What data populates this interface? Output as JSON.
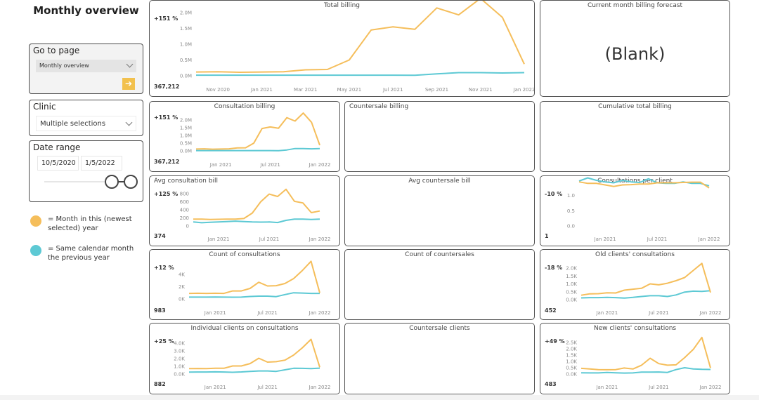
{
  "page": {
    "title": "Monthly overview"
  },
  "slicers": {
    "goto_page": {
      "label": "Go to page",
      "selected": "Monthly overview",
      "go_icon": "➔"
    },
    "clinic": {
      "label": "Clinic",
      "selected": "Multiple selections"
    },
    "date_range": {
      "label": "Date range",
      "start": "10/5/2020",
      "end": "1/5/2022"
    }
  },
  "legend": [
    {
      "text": "= Month in this (newest selected) year",
      "color": "#F5BE5B"
    },
    {
      "text": "= Same calendar month the previous year",
      "color": "#5DC9D4"
    }
  ],
  "colors": {
    "current": "#F5BE5B",
    "previous": "#5DC9D4"
  },
  "blank_cards": {
    "forecast": {
      "title": "Current month billing forecast",
      "text": "(Blank)"
    },
    "cumulative": {
      "title": "Cumulative total billing"
    },
    "countersale_billing": {
      "title": "Countersale billing"
    },
    "avg_countersale": {
      "title": "Avg countersale bill"
    },
    "count_countersales": {
      "title": "Count of countersales"
    },
    "countersale_clients": {
      "title": "Countersale clients"
    }
  },
  "chart_data": [
    {
      "id": "total_billing",
      "type": "line",
      "title": "Total billing",
      "kpi_pct": "+151 %",
      "kpi_value": "367,212",
      "x": [
        "Oct 2020",
        "Nov 2020",
        "Dec 2020",
        "Jan 2021",
        "Feb 2021",
        "Mar 2021",
        "Apr 2021",
        "May 2021",
        "Jun 2021",
        "Jul 2021",
        "Aug 2021",
        "Sep 2021",
        "Oct 2021",
        "Nov 2021",
        "Dec 2021",
        "Jan 2022"
      ],
      "xticks": [
        "Nov 2020",
        "Jan 2021",
        "Mar 2021",
        "May 2021",
        "Jul 2021",
        "Sep 2021",
        "Nov 2021",
        "Jan 2022"
      ],
      "xtick_idx": [
        1,
        3,
        5,
        7,
        9,
        11,
        13,
        15
      ],
      "yticks": [
        "0.0M",
        "0.5M",
        "1.0M",
        "1.5M",
        "2.0M"
      ],
      "ylim": [
        0,
        2000000
      ],
      "series": [
        {
          "name": "Current year",
          "values": [
            120000,
            130000,
            110000,
            120000,
            130000,
            190000,
            200000,
            500000,
            1450000,
            1550000,
            1470000,
            2150000,
            1930000,
            2450000,
            1850000,
            370000
          ]
        },
        {
          "name": "Previous year",
          "values": [
            20000,
            20000,
            20000,
            20000,
            20000,
            20000,
            20000,
            20000,
            20000,
            20000,
            15000,
            60000,
            100000,
            100000,
            90000,
            100000
          ]
        }
      ]
    },
    {
      "id": "consultation_billing",
      "type": "line",
      "title": "Consultation billing",
      "kpi_pct": "+151 %",
      "kpi_value": "367,212",
      "x": [
        "Oct 2020",
        "Nov 2020",
        "Dec 2020",
        "Jan 2021",
        "Feb 2021",
        "Mar 2021",
        "Apr 2021",
        "May 2021",
        "Jun 2021",
        "Jul 2021",
        "Aug 2021",
        "Sep 2021",
        "Oct 2021",
        "Nov 2021",
        "Dec 2021",
        "Jan 2022"
      ],
      "xticks": [
        "Jan 2021",
        "Jul 2021",
        "Jan 2022"
      ],
      "xtick_idx": [
        3,
        9,
        15
      ],
      "yticks": [
        "0.0M",
        "0.5M",
        "1.0M",
        "1.5M",
        "2.0M"
      ],
      "ylim": [
        0,
        2000000
      ],
      "series": [
        {
          "name": "Current year",
          "values": [
            120000,
            130000,
            110000,
            120000,
            130000,
            190000,
            200000,
            500000,
            1450000,
            1550000,
            1470000,
            2150000,
            1930000,
            2450000,
            1850000,
            370000
          ]
        },
        {
          "name": "Previous year",
          "values": [
            20000,
            20000,
            20000,
            20000,
            20000,
            20000,
            20000,
            20000,
            20000,
            20000,
            15000,
            60000,
            150000,
            150000,
            130000,
            150000
          ]
        }
      ]
    },
    {
      "id": "avg_consultation_bill",
      "type": "line",
      "title": "Avg consultation bill",
      "kpi_pct": "+125 %",
      "kpi_value": "374",
      "x": [
        "Oct 2020",
        "Nov 2020",
        "Dec 2020",
        "Jan 2021",
        "Feb 2021",
        "Mar 2021",
        "Apr 2021",
        "May 2021",
        "Jun 2021",
        "Jul 2021",
        "Aug 2021",
        "Sep 2021",
        "Oct 2021",
        "Nov 2021",
        "Dec 2021",
        "Jan 2022"
      ],
      "xticks": [
        "Jan 2021",
        "Jul 2021",
        "Jan 2022"
      ],
      "xtick_idx": [
        3,
        9,
        15
      ],
      "yticks": [
        "0",
        "200",
        "400",
        "600",
        "800"
      ],
      "ylim": [
        0,
        800
      ],
      "series": [
        {
          "name": "Current year",
          "values": [
            170,
            170,
            160,
            165,
            170,
            170,
            185,
            320,
            600,
            790,
            730,
            910,
            610,
            570,
            330,
            370
          ]
        },
        {
          "name": "Previous year",
          "values": [
            100,
            80,
            90,
            100,
            110,
            120,
            110,
            100,
            95,
            100,
            85,
            140,
            170,
            170,
            160,
            170
          ]
        }
      ]
    },
    {
      "id": "consultations_per_client",
      "type": "line",
      "title": "Consultations per client",
      "kpi_pct": "-10 %",
      "kpi_value": "1",
      "x": [
        "Oct 2020",
        "Nov 2020",
        "Dec 2020",
        "Jan 2021",
        "Feb 2021",
        "Mar 2021",
        "Apr 2021",
        "May 2021",
        "Jun 2021",
        "Jul 2021",
        "Aug 2021",
        "Sep 2021",
        "Oct 2021",
        "Nov 2021",
        "Dec 2021",
        "Jan 2022"
      ],
      "xticks": [
        "Jan 2021",
        "Jul 2021",
        "Jan 2022"
      ],
      "xtick_idx": [
        3,
        9,
        15
      ],
      "yticks": [
        "0.0",
        "0.5",
        "1.0"
      ],
      "ylim": [
        0,
        1.5
      ],
      "series": [
        {
          "name": "Current year",
          "values": [
            1.45,
            1.4,
            1.4,
            1.35,
            1.3,
            1.35,
            1.36,
            1.38,
            1.38,
            1.42,
            1.42,
            1.42,
            1.43,
            1.44,
            1.44,
            1.25
          ]
        },
        {
          "name": "Previous year",
          "values": [
            1.48,
            1.58,
            1.5,
            1.45,
            1.42,
            1.5,
            1.45,
            1.43,
            1.55,
            1.42,
            1.4,
            1.4,
            1.45,
            1.4,
            1.4,
            1.32
          ]
        }
      ]
    },
    {
      "id": "count_of_consultations",
      "type": "line",
      "title": "Count of consultations",
      "kpi_pct": "+12 %",
      "kpi_value": "983",
      "x": [
        "Oct 2020",
        "Nov 2020",
        "Dec 2020",
        "Jan 2021",
        "Feb 2021",
        "Mar 2021",
        "Apr 2021",
        "May 2021",
        "Jun 2021",
        "Jul 2021",
        "Aug 2021",
        "Sep 2021",
        "Oct 2021",
        "Nov 2021",
        "Dec 2021",
        "Jan 2022"
      ],
      "xticks": [
        "Jan 2021",
        "Jul 2021",
        "Jan 2022"
      ],
      "xtick_idx": [
        3,
        9,
        15
      ],
      "yticks": [
        "0K",
        "2K",
        "4K"
      ],
      "ylim": [
        0,
        5000
      ],
      "series": [
        {
          "name": "Current year",
          "values": [
            900,
            920,
            900,
            920,
            900,
            1300,
            1300,
            1700,
            2700,
            2100,
            2150,
            2500,
            3300,
            4600,
            6100,
            983
          ]
        },
        {
          "name": "Previous year",
          "values": [
            300,
            300,
            300,
            320,
            300,
            280,
            300,
            400,
            450,
            450,
            380,
            700,
            1000,
            950,
            900,
            900
          ]
        }
      ]
    },
    {
      "id": "old_clients_consultations",
      "type": "line",
      "title": "Old clients' consultations",
      "kpi_pct": "-18 %",
      "kpi_value": "452",
      "x": [
        "Oct 2020",
        "Nov 2020",
        "Dec 2020",
        "Jan 2021",
        "Feb 2021",
        "Mar 2021",
        "Apr 2021",
        "May 2021",
        "Jun 2021",
        "Jul 2021",
        "Aug 2021",
        "Sep 2021",
        "Oct 2021",
        "Nov 2021",
        "Dec 2021",
        "Jan 2022"
      ],
      "xticks": [
        "Jan 2021",
        "Jul 2021",
        "Jan 2022"
      ],
      "xtick_idx": [
        3,
        9,
        15
      ],
      "yticks": [
        "0.0K",
        "0.5K",
        "1.0K",
        "1.5K",
        "2.0K"
      ],
      "ylim": [
        0,
        2000
      ],
      "series": [
        {
          "name": "Current year",
          "values": [
            280,
            370,
            380,
            430,
            420,
            600,
            660,
            720,
            1000,
            940,
            1040,
            1200,
            1400,
            1850,
            2300,
            452
          ]
        },
        {
          "name": "Previous year",
          "values": [
            110,
            130,
            130,
            140,
            130,
            100,
            140,
            200,
            250,
            250,
            200,
            300,
            480,
            540,
            520,
            570
          ]
        }
      ]
    },
    {
      "id": "individual_clients_on_consultations",
      "type": "line",
      "title": "Individual clients on consultations",
      "kpi_pct": "+25 %",
      "kpi_value": "882",
      "x": [
        "Oct 2020",
        "Nov 2020",
        "Dec 2020",
        "Jan 2021",
        "Feb 2021",
        "Mar 2021",
        "Apr 2021",
        "May 2021",
        "Jun 2021",
        "Jul 2021",
        "Aug 2021",
        "Sep 2021",
        "Oct 2021",
        "Nov 2021",
        "Dec 2021",
        "Jan 2022"
      ],
      "xticks": [
        "Jan 2021",
        "Jul 2021",
        "Jan 2022"
      ],
      "xtick_idx": [
        3,
        9,
        15
      ],
      "yticks": [
        "0.0K",
        "1.0K",
        "2.0K",
        "3.0K",
        "4.0K"
      ],
      "ylim": [
        0,
        4000
      ],
      "series": [
        {
          "name": "Current year",
          "values": [
            700,
            720,
            700,
            750,
            750,
            1050,
            1050,
            1350,
            2050,
            1550,
            1600,
            1800,
            2450,
            3400,
            4500,
            882
          ]
        },
        {
          "name": "Previous year",
          "values": [
            250,
            260,
            260,
            280,
            260,
            230,
            270,
            350,
            400,
            400,
            350,
            550,
            750,
            740,
            700,
            760
          ]
        }
      ]
    },
    {
      "id": "new_clients_consultations",
      "type": "line",
      "title": "New clients' consultations",
      "kpi_pct": "+49 %",
      "kpi_value": "483",
      "x": [
        "Oct 2020",
        "Nov 2020",
        "Dec 2020",
        "Jan 2021",
        "Feb 2021",
        "Mar 2021",
        "Apr 2021",
        "May 2021",
        "Jun 2021",
        "Jul 2021",
        "Aug 2021",
        "Sep 2021",
        "Oct 2021",
        "Nov 2021",
        "Dec 2021",
        "Jan 2022"
      ],
      "xticks": [
        "Jan 2021",
        "Jul 2021",
        "Jan 2022"
      ],
      "xtick_idx": [
        3,
        9,
        15
      ],
      "yticks": [
        "0.0K",
        "0.5K",
        "1.0K",
        "1.5K",
        "2.0K",
        "2.5K"
      ],
      "ylim": [
        0,
        2500
      ],
      "series": [
        {
          "name": "Current year",
          "values": [
            450,
            400,
            350,
            340,
            350,
            480,
            400,
            700,
            1250,
            820,
            700,
            730,
            1300,
            1950,
            2900,
            483
          ]
        },
        {
          "name": "Previous year",
          "values": [
            100,
            90,
            90,
            120,
            100,
            80,
            90,
            150,
            150,
            160,
            130,
            350,
            500,
            400,
            370,
            360
          ]
        }
      ]
    }
  ]
}
